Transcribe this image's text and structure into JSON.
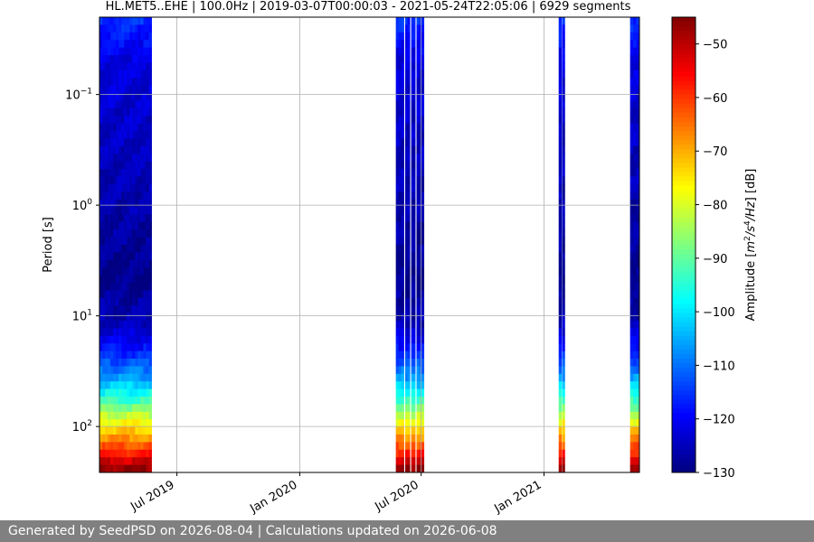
{
  "chart_data": {
    "type": "heatmap",
    "title": "HL.MET5..EHE | 100.0Hz | 2019-03-07T00:00:03 - 2021-05-24T22:05:06 | 6929 segments",
    "ylabel": "Period [s]",
    "xlabel": "",
    "colorbar_label": "Amplitude [m²/s⁴/Hz] [dB]",
    "colorbar_label_parts": [
      "Amplitude [",
      "m",
      "2",
      "/",
      "s",
      "4",
      "/",
      "Hz",
      "] [dB]"
    ],
    "colormap": "jet",
    "clim": [
      -130,
      -45
    ],
    "colorbar_ticks": [
      -50,
      -60,
      -70,
      -80,
      -90,
      -100,
      -110,
      -120,
      -130
    ],
    "xlim": [
      "2019-03-07",
      "2021-05-24"
    ],
    "x_ticks": [
      {
        "date": "2019-07-01",
        "label": "Jul 2019"
      },
      {
        "date": "2020-01-01",
        "label": "Jan 2020"
      },
      {
        "date": "2020-07-01",
        "label": "Jul 2020"
      },
      {
        "date": "2021-01-01",
        "label": "Jan 2021"
      }
    ],
    "y_scale": "log",
    "y_inverted": true,
    "ylim": [
      0.02,
      260
    ],
    "y_ticks": [
      {
        "value": 0.1,
        "base": "10",
        "exp": "−1"
      },
      {
        "value": 1,
        "base": "10",
        "exp": "0"
      },
      {
        "value": 10,
        "base": "10",
        "exp": "1"
      },
      {
        "value": 100,
        "base": "10",
        "exp": "2"
      }
    ],
    "grid": true,
    "data_segments": [
      {
        "start": "2019-03-07",
        "end": "2019-05-24"
      },
      {
        "start": "2020-05-24",
        "end": "2020-06-05"
      },
      {
        "start": "2020-06-07",
        "end": "2020-06-14"
      },
      {
        "start": "2020-06-16",
        "end": "2020-06-22"
      },
      {
        "start": "2020-06-24",
        "end": "2020-07-05"
      },
      {
        "start": "2021-01-23",
        "end": "2021-01-27"
      },
      {
        "start": "2021-01-28",
        "end": "2021-02-01"
      },
      {
        "start": "2021-05-10",
        "end": "2021-05-24"
      }
    ],
    "psd_profile_by_period": [
      {
        "period": 0.02,
        "db": -115
      },
      {
        "period": 0.05,
        "db": -122
      },
      {
        "period": 0.2,
        "db": -124
      },
      {
        "period": 1,
        "db": -126
      },
      {
        "period": 5,
        "db": -129
      },
      {
        "period": 12,
        "db": -125
      },
      {
        "period": 20,
        "db": -118
      },
      {
        "period": 35,
        "db": -107
      },
      {
        "period": 55,
        "db": -95
      },
      {
        "period": 80,
        "db": -82
      },
      {
        "period": 110,
        "db": -72
      },
      {
        "period": 140,
        "db": -65
      },
      {
        "period": 180,
        "db": -57
      },
      {
        "period": 220,
        "db": -49
      },
      {
        "period": 260,
        "db": -45
      }
    ]
  },
  "footer": {
    "text": "Generated by SeedPSD on 2026-08-04 | Calculations updated on 2026-06-08"
  }
}
